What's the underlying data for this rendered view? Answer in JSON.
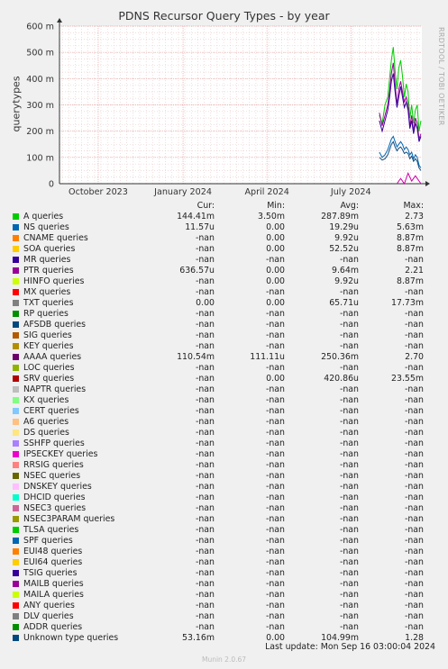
{
  "title": "PDNS Recursor Query Types - by year",
  "side_text": "RRDTOOL / TOBI OETIKER",
  "footer": "Last update: Mon Sep 16 03:00:04 2024",
  "munin": "Munin 2.0.67",
  "headers": {
    "cur": "Cur:",
    "min": "Min:",
    "avg": "Avg:",
    "max": "Max:"
  },
  "chart_data": {
    "type": "line",
    "title": "PDNS Recursor Query Types - by year",
    "ylabel": "querytypes",
    "ylim": [
      0,
      600
    ],
    "yticks": [
      "0",
      "100 m",
      "200 m",
      "300 m",
      "400 m",
      "500 m",
      "600 m"
    ],
    "ytick_values": [
      0,
      100,
      200,
      300,
      400,
      500,
      600
    ],
    "x_range": [
      "2023-08-20",
      "2024-09-16"
    ],
    "xtick_labels": [
      "October 2023",
      "January 2024",
      "April 2024",
      "July 2024"
    ],
    "xtick_dates": [
      "2023-10-01",
      "2024-01-01",
      "2024-04-01",
      "2024-07-01"
    ],
    "grid": true,
    "series": [
      {
        "name": "A queries",
        "color": "#00cc00",
        "x": [
          "2024-08-01",
          "2024-08-04",
          "2024-08-07",
          "2024-08-10",
          "2024-08-12",
          "2024-08-14",
          "2024-08-16",
          "2024-08-18",
          "2024-08-20",
          "2024-08-22",
          "2024-08-24",
          "2024-08-26",
          "2024-08-28",
          "2024-08-30",
          "2024-09-01",
          "2024-09-03",
          "2024-09-05",
          "2024-09-07",
          "2024-09-09",
          "2024-09-11",
          "2024-09-13",
          "2024-09-15"
        ],
        "y": [
          260,
          230,
          300,
          330,
          400,
          470,
          520,
          430,
          360,
          440,
          470,
          410,
          330,
          380,
          350,
          250,
          300,
          230,
          280,
          300,
          200,
          240
        ]
      },
      {
        "name": "PTR queries",
        "color": "#990099",
        "x": [
          "2024-08-01",
          "2024-08-04",
          "2024-08-07",
          "2024-08-10",
          "2024-08-12",
          "2024-08-14",
          "2024-08-16",
          "2024-08-18",
          "2024-08-20",
          "2024-08-22",
          "2024-08-24",
          "2024-08-26",
          "2024-08-28",
          "2024-08-30",
          "2024-09-01",
          "2024-09-03",
          "2024-09-05",
          "2024-09-07",
          "2024-09-09",
          "2024-09-11",
          "2024-09-13",
          "2024-09-15"
        ],
        "y": [
          270,
          220,
          260,
          300,
          350,
          420,
          460,
          380,
          300,
          360,
          390,
          350,
          310,
          330,
          300,
          220,
          260,
          200,
          250,
          230,
          170,
          190
        ]
      },
      {
        "name": "AAAA queries",
        "color": "#330099",
        "x": [
          "2024-08-01",
          "2024-08-04",
          "2024-08-07",
          "2024-08-10",
          "2024-08-12",
          "2024-08-14",
          "2024-08-16",
          "2024-08-18",
          "2024-08-20",
          "2024-08-22",
          "2024-08-24",
          "2024-08-26",
          "2024-08-28",
          "2024-08-30",
          "2024-09-01",
          "2024-09-03",
          "2024-09-05",
          "2024-09-07",
          "2024-09-09",
          "2024-09-11",
          "2024-09-13",
          "2024-09-15"
        ],
        "y": [
          240,
          200,
          240,
          280,
          330,
          390,
          420,
          350,
          290,
          330,
          370,
          330,
          290,
          310,
          280,
          210,
          240,
          190,
          230,
          210,
          160,
          180
        ]
      },
      {
        "name": "NS queries",
        "color": "#0066b3",
        "x": [
          "2024-08-01",
          "2024-08-04",
          "2024-08-07",
          "2024-08-10",
          "2024-08-12",
          "2024-08-14",
          "2024-08-16",
          "2024-08-18",
          "2024-08-20",
          "2024-08-22",
          "2024-08-24",
          "2024-08-26",
          "2024-08-28",
          "2024-08-30",
          "2024-09-01",
          "2024-09-03",
          "2024-09-05",
          "2024-09-07",
          "2024-09-09",
          "2024-09-11",
          "2024-09-13",
          "2024-09-15"
        ],
        "y": [
          120,
          100,
          110,
          130,
          150,
          170,
          180,
          160,
          140,
          150,
          160,
          150,
          130,
          140,
          130,
          110,
          120,
          95,
          110,
          100,
          70,
          60
        ]
      },
      {
        "name": "Unknown type queries",
        "color": "#0f4c7f",
        "x": [
          "2024-08-01",
          "2024-08-04",
          "2024-08-07",
          "2024-08-10",
          "2024-08-12",
          "2024-08-14",
          "2024-08-16",
          "2024-08-18",
          "2024-08-20",
          "2024-08-22",
          "2024-08-24",
          "2024-08-26",
          "2024-08-28",
          "2024-08-30",
          "2024-09-01",
          "2024-09-03",
          "2024-09-05",
          "2024-09-07",
          "2024-09-09",
          "2024-09-11",
          "2024-09-13",
          "2024-09-15"
        ],
        "y": [
          100,
          90,
          95,
          110,
          130,
          150,
          160,
          140,
          125,
          135,
          140,
          130,
          115,
          120,
          115,
          95,
          105,
          85,
          95,
          85,
          60,
          50
        ]
      },
      {
        "name": "TXT queries",
        "color": "#cc00aa",
        "x": [
          "2024-08-20",
          "2024-08-24",
          "2024-08-28",
          "2024-09-01",
          "2024-09-05",
          "2024-09-09",
          "2024-09-15"
        ],
        "y": [
          0,
          20,
          0,
          40,
          10,
          30,
          0
        ]
      }
    ]
  },
  "legend": [
    {
      "name": "A queries",
      "color": "#00cc00",
      "cur": "144.41m",
      "min": "3.50m",
      "avg": "287.89m",
      "max": "2.73"
    },
    {
      "name": "NS queries",
      "color": "#0066b3",
      "cur": "11.57u",
      "min": "0.00",
      "avg": "19.29u",
      "max": "5.63m"
    },
    {
      "name": "CNAME queries",
      "color": "#ff8000",
      "cur": "-nan",
      "min": "0.00",
      "avg": "9.92u",
      "max": "8.87m"
    },
    {
      "name": "SOA queries",
      "color": "#ffcc00",
      "cur": "-nan",
      "min": "0.00",
      "avg": "52.52u",
      "max": "8.87m"
    },
    {
      "name": "MR queries",
      "color": "#330099",
      "cur": "-nan",
      "min": "-nan",
      "avg": "-nan",
      "max": "-nan"
    },
    {
      "name": "PTR queries",
      "color": "#990099",
      "cur": "636.57u",
      "min": "0.00",
      "avg": "9.64m",
      "max": "2.21"
    },
    {
      "name": "HINFO queries",
      "color": "#ccff00",
      "cur": "-nan",
      "min": "0.00",
      "avg": "9.92u",
      "max": "8.87m"
    },
    {
      "name": "MX queries",
      "color": "#ff0000",
      "cur": "-nan",
      "min": "-nan",
      "avg": "-nan",
      "max": "-nan"
    },
    {
      "name": "TXT queries",
      "color": "#808080",
      "cur": "0.00",
      "min": "0.00",
      "avg": "65.71u",
      "max": "17.73m"
    },
    {
      "name": "RP queries",
      "color": "#008f00",
      "cur": "-nan",
      "min": "-nan",
      "avg": "-nan",
      "max": "-nan"
    },
    {
      "name": "AFSDB queries",
      "color": "#00487d",
      "cur": "-nan",
      "min": "-nan",
      "avg": "-nan",
      "max": "-nan"
    },
    {
      "name": "SIG queries",
      "color": "#b35a00",
      "cur": "-nan",
      "min": "-nan",
      "avg": "-nan",
      "max": "-nan"
    },
    {
      "name": "KEY queries",
      "color": "#b38f00",
      "cur": "-nan",
      "min": "-nan",
      "avg": "-nan",
      "max": "-nan"
    },
    {
      "name": "AAAA queries",
      "color": "#6b006b",
      "cur": "110.54m",
      "min": "111.11u",
      "avg": "250.36m",
      "max": "2.70"
    },
    {
      "name": "LOC queries",
      "color": "#8fb300",
      "cur": "-nan",
      "min": "-nan",
      "avg": "-nan",
      "max": "-nan"
    },
    {
      "name": "SRV queries",
      "color": "#b30000",
      "cur": "-nan",
      "min": "0.00",
      "avg": "420.86u",
      "max": "23.55m"
    },
    {
      "name": "NAPTR queries",
      "color": "#bebebe",
      "cur": "-nan",
      "min": "-nan",
      "avg": "-nan",
      "max": "-nan"
    },
    {
      "name": "KX queries",
      "color": "#80ff80",
      "cur": "-nan",
      "min": "-nan",
      "avg": "-nan",
      "max": "-nan"
    },
    {
      "name": "CERT queries",
      "color": "#80c9ff",
      "cur": "-nan",
      "min": "-nan",
      "avg": "-nan",
      "max": "-nan"
    },
    {
      "name": "A6 queries",
      "color": "#ffc080",
      "cur": "-nan",
      "min": "-nan",
      "avg": "-nan",
      "max": "-nan"
    },
    {
      "name": "DS queries",
      "color": "#ffe680",
      "cur": "-nan",
      "min": "-nan",
      "avg": "-nan",
      "max": "-nan"
    },
    {
      "name": "SSHFP queries",
      "color": "#aa80ff",
      "cur": "-nan",
      "min": "-nan",
      "avg": "-nan",
      "max": "-nan"
    },
    {
      "name": "IPSECKEY queries",
      "color": "#ee00cc",
      "cur": "-nan",
      "min": "-nan",
      "avg": "-nan",
      "max": "-nan"
    },
    {
      "name": "RRSIG queries",
      "color": "#ff8080",
      "cur": "-nan",
      "min": "-nan",
      "avg": "-nan",
      "max": "-nan"
    },
    {
      "name": "NSEC queries",
      "color": "#666600",
      "cur": "-nan",
      "min": "-nan",
      "avg": "-nan",
      "max": "-nan"
    },
    {
      "name": "DNSKEY queries",
      "color": "#ffbfff",
      "cur": "-nan",
      "min": "-nan",
      "avg": "-nan",
      "max": "-nan"
    },
    {
      "name": "DHCID queries",
      "color": "#00ffcc",
      "cur": "-nan",
      "min": "-nan",
      "avg": "-nan",
      "max": "-nan"
    },
    {
      "name": "NSEC3 queries",
      "color": "#cc6699",
      "cur": "-nan",
      "min": "-nan",
      "avg": "-nan",
      "max": "-nan"
    },
    {
      "name": "NSEC3PARAM queries",
      "color": "#999900",
      "cur": "-nan",
      "min": "-nan",
      "avg": "-nan",
      "max": "-nan"
    },
    {
      "name": "TLSA queries",
      "color": "#00cc00",
      "cur": "-nan",
      "min": "-nan",
      "avg": "-nan",
      "max": "-nan"
    },
    {
      "name": "SPF queries",
      "color": "#0066b3",
      "cur": "-nan",
      "min": "-nan",
      "avg": "-nan",
      "max": "-nan"
    },
    {
      "name": "EUI48 queries",
      "color": "#ff8000",
      "cur": "-nan",
      "min": "-nan",
      "avg": "-nan",
      "max": "-nan"
    },
    {
      "name": "EUI64 queries",
      "color": "#ffcc00",
      "cur": "-nan",
      "min": "-nan",
      "avg": "-nan",
      "max": "-nan"
    },
    {
      "name": "TSIG queries",
      "color": "#330099",
      "cur": "-nan",
      "min": "-nan",
      "avg": "-nan",
      "max": "-nan"
    },
    {
      "name": "MAILB queries",
      "color": "#990099",
      "cur": "-nan",
      "min": "-nan",
      "avg": "-nan",
      "max": "-nan"
    },
    {
      "name": "MAILA queries",
      "color": "#ccff00",
      "cur": "-nan",
      "min": "-nan",
      "avg": "-nan",
      "max": "-nan"
    },
    {
      "name": "ANY queries",
      "color": "#ff0000",
      "cur": "-nan",
      "min": "-nan",
      "avg": "-nan",
      "max": "-nan"
    },
    {
      "name": "DLV queries",
      "color": "#808080",
      "cur": "-nan",
      "min": "-nan",
      "avg": "-nan",
      "max": "-nan"
    },
    {
      "name": "ADDR queries",
      "color": "#008f00",
      "cur": "-nan",
      "min": "-nan",
      "avg": "-nan",
      "max": "-nan"
    },
    {
      "name": "Unknown type queries",
      "color": "#00487d",
      "cur": "53.16m",
      "min": "0.00",
      "avg": "104.99m",
      "max": "1.28"
    }
  ]
}
